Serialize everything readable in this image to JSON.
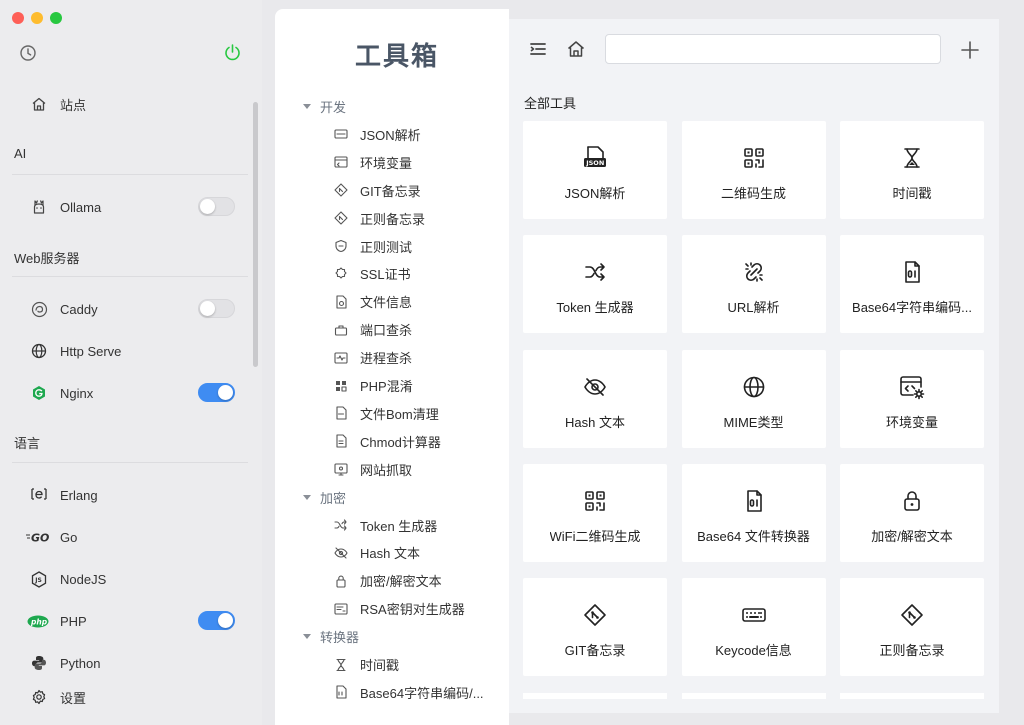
{
  "sidebar": {
    "items_top": [
      {
        "label": "站点",
        "icon": "home-icon"
      }
    ],
    "sections": [
      {
        "title": "AI",
        "items": [
          {
            "label": "Ollama",
            "icon": "llama-icon",
            "toggle": false
          }
        ]
      },
      {
        "title": "Web服务器",
        "items": [
          {
            "label": "Caddy",
            "icon": "caddy-icon",
            "toggle": false
          },
          {
            "label": "Http Serve",
            "icon": "globe-icon"
          },
          {
            "label": "Nginx",
            "icon": "nginx-icon",
            "toggle": true
          }
        ]
      },
      {
        "title": "语言",
        "items": [
          {
            "label": "Erlang",
            "icon": "erlang-icon"
          },
          {
            "label": "Go",
            "icon": "go-icon"
          },
          {
            "label": "NodeJS",
            "icon": "nodejs-icon"
          },
          {
            "label": "PHP",
            "icon": "php-icon",
            "toggle": true
          },
          {
            "label": "Python",
            "icon": "python-icon"
          }
        ]
      }
    ],
    "settings": {
      "label": "设置",
      "icon": "gear-icon"
    },
    "colors": {
      "toggle_on": "#3f8cf2",
      "power": "#28c840"
    }
  },
  "tree": {
    "title": "工具箱",
    "groups": [
      {
        "label": "开发",
        "items": [
          "JSON解析",
          "环境变量",
          "GIT备忘录",
          "正则备忘录",
          "正则测试",
          "SSL证书",
          "文件信息",
          "端口查杀",
          "进程查杀",
          "PHP混淆",
          "文件Bom清理",
          "Chmod计算器",
          "网站抓取"
        ]
      },
      {
        "label": "加密",
        "items": [
          "Token 生成器",
          "Hash 文本",
          "加密/解密文本",
          "RSA密钥对生成器"
        ]
      },
      {
        "label": "转换器",
        "items": [
          "时间戳",
          "Base64字符串编码/..."
        ]
      }
    ]
  },
  "main": {
    "search": {
      "value": "",
      "placeholder": ""
    },
    "section_title": "全部工具",
    "cards": [
      {
        "label": "JSON解析",
        "icon": "json-file-icon"
      },
      {
        "label": "二维码生成",
        "icon": "qrcode-icon"
      },
      {
        "label": "时间戳",
        "icon": "hourglass-icon"
      },
      {
        "label": "Token 生成器",
        "icon": "shuffle-icon"
      },
      {
        "label": "URL解析",
        "icon": "link-broken-icon"
      },
      {
        "label": "Base64字符串编码...",
        "icon": "binary-file-icon"
      },
      {
        "label": "Hash 文本",
        "icon": "eye-off-icon"
      },
      {
        "label": "MIME类型",
        "icon": "globe-icon"
      },
      {
        "label": "环境变量",
        "icon": "code-window-gear-icon"
      },
      {
        "label": "WiFi二维码生成",
        "icon": "qrcode-icon"
      },
      {
        "label": "Base64 文件转换器",
        "icon": "binary-file-icon"
      },
      {
        "label": "加密/解密文本",
        "icon": "lock-icon"
      },
      {
        "label": "GIT备忘录",
        "icon": "git-icon"
      },
      {
        "label": "Keycode信息",
        "icon": "keyboard-icon"
      },
      {
        "label": "正则备忘录",
        "icon": "git-icon"
      }
    ]
  }
}
